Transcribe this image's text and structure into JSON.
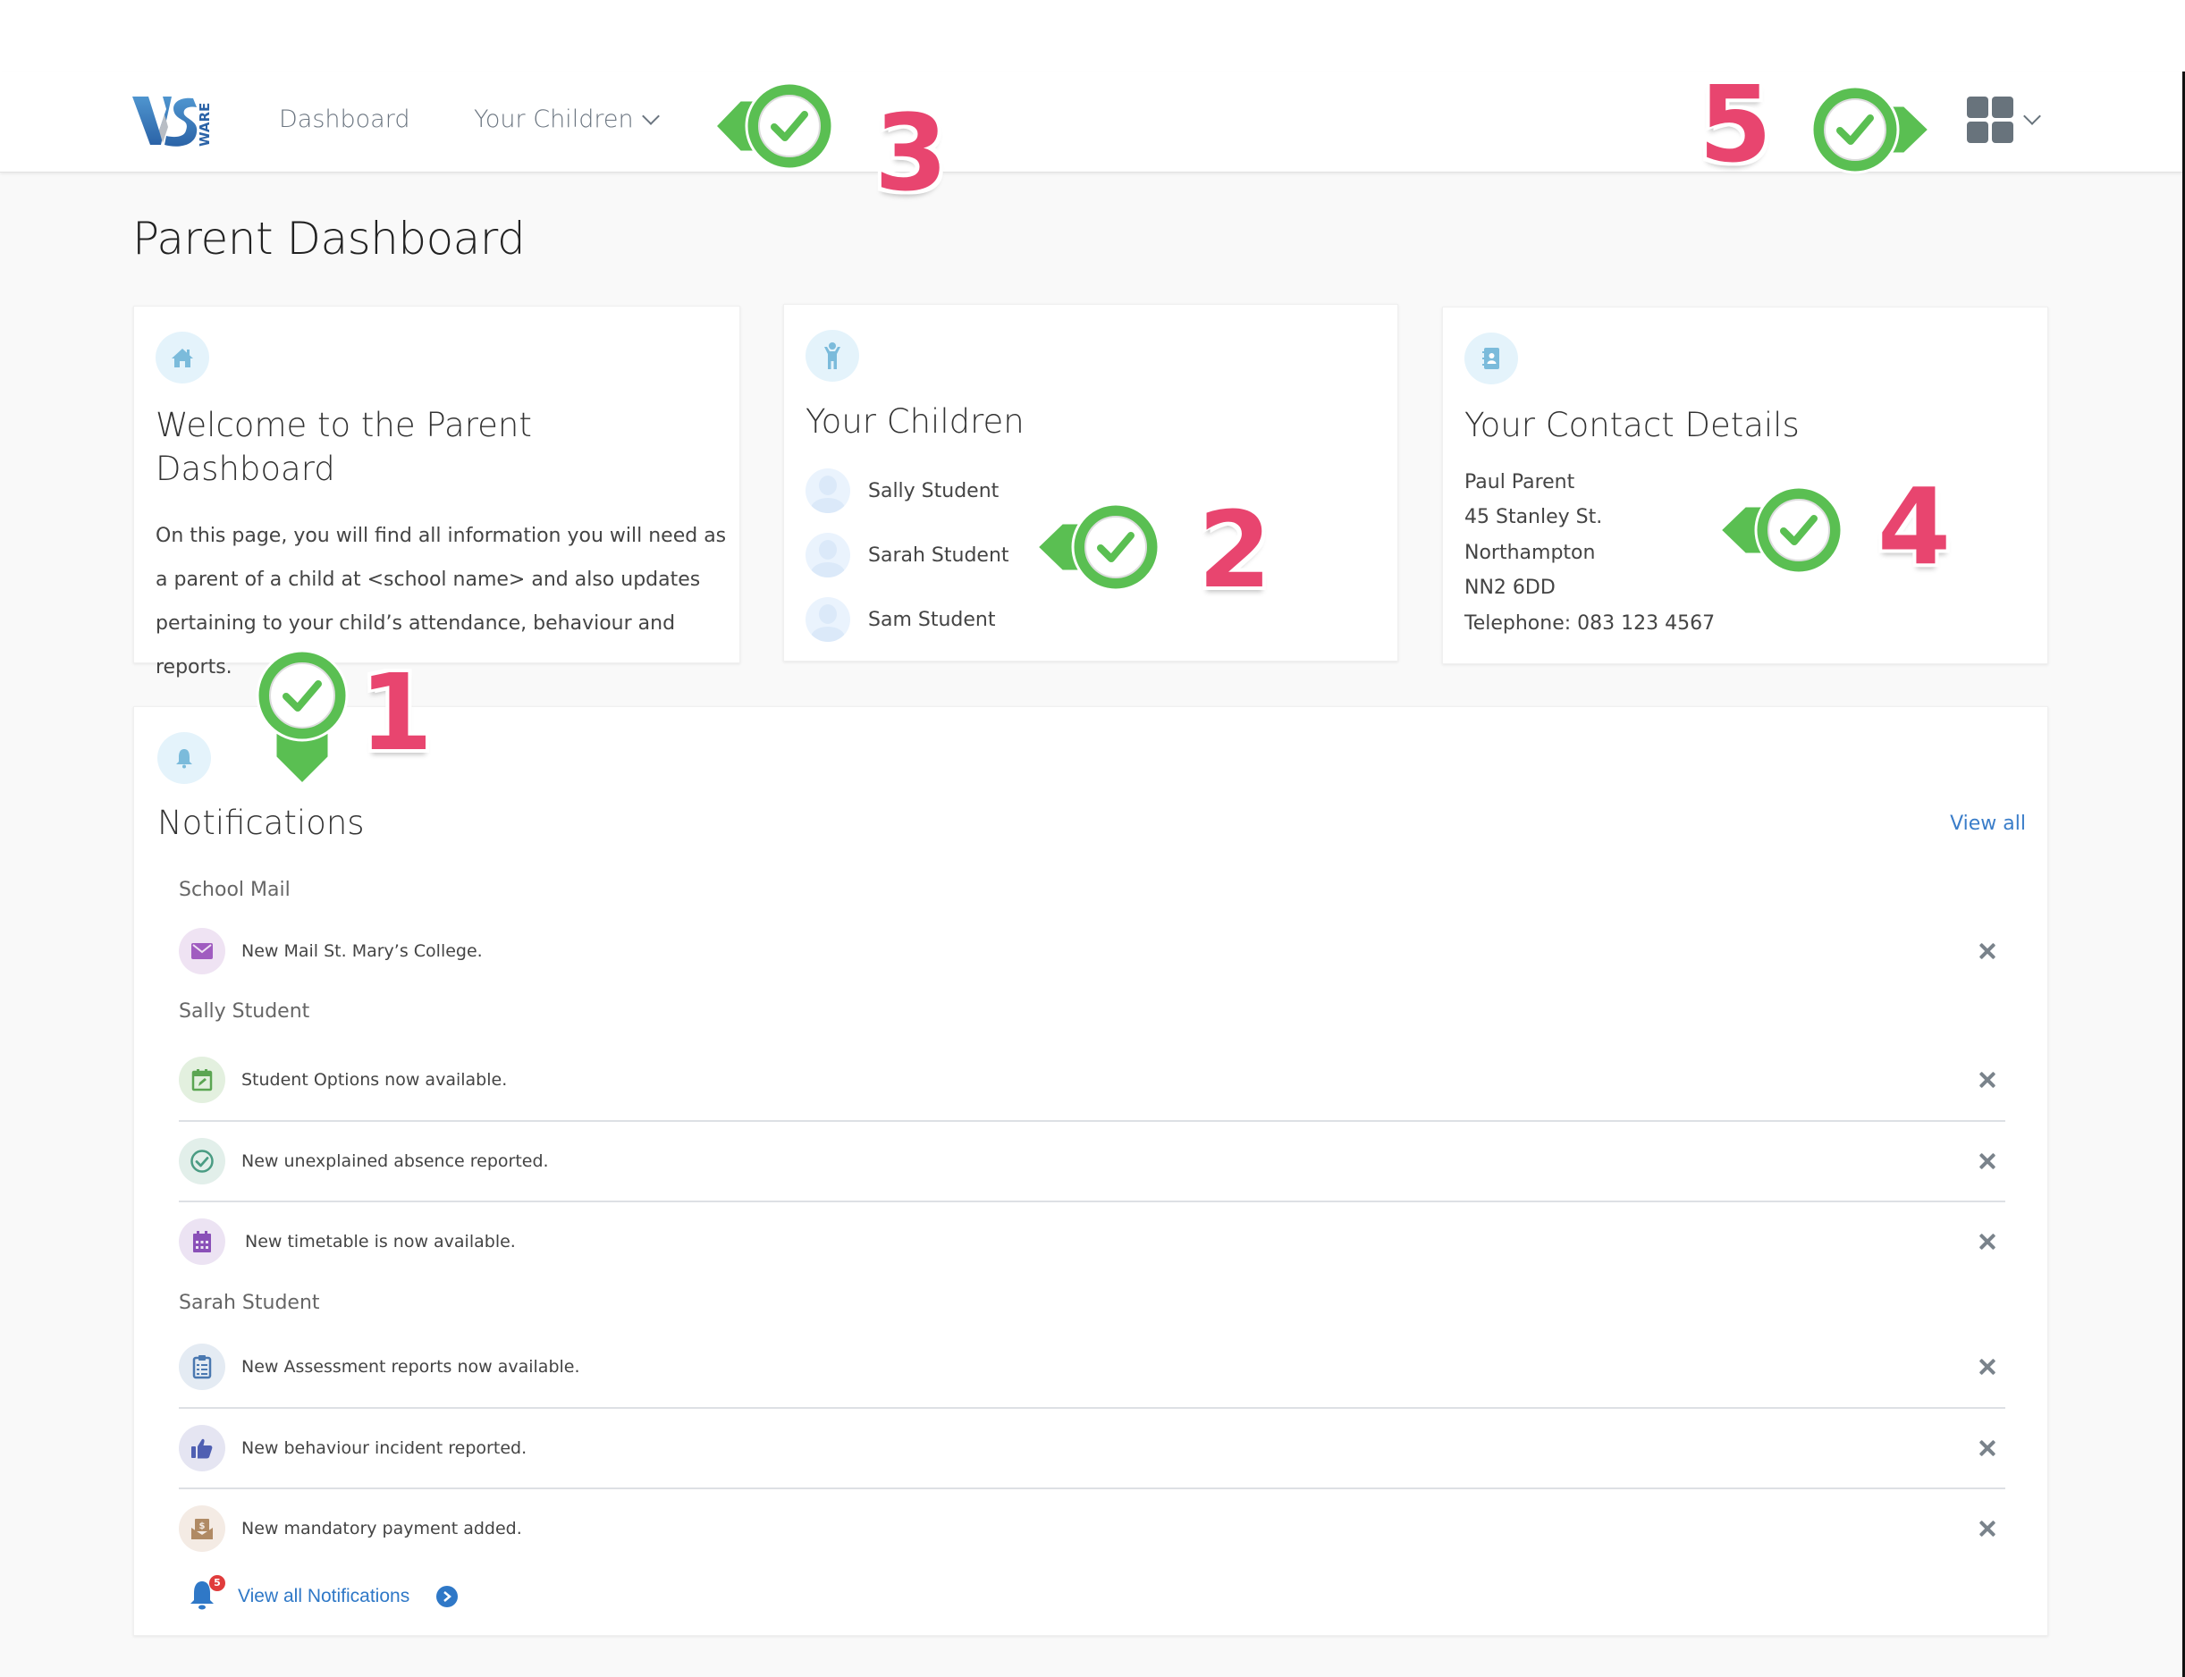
{
  "header": {
    "logo_alt": "VSware",
    "nav": [
      {
        "label": "Dashboard"
      },
      {
        "label": "Your Children",
        "has_dropdown": true
      }
    ],
    "apps_menu_icon": "grid-icon"
  },
  "page": {
    "title": "Parent Dashboard"
  },
  "welcome_card": {
    "icon": "home-icon",
    "title": "Welcome to the Parent Dashboard",
    "body": "On this page, you will find all information you will need as a parent of a child at <school name> and also updates pertaining to your child’s attendance, behaviour and reports."
  },
  "children_card": {
    "icon": "child-icon",
    "title": "Your Children",
    "children": [
      {
        "name": "Sally Student"
      },
      {
        "name": "Sarah Student"
      },
      {
        "name": "Sam Student"
      }
    ]
  },
  "contact_card": {
    "icon": "address-book-icon",
    "title": "Your Contact Details",
    "lines": [
      "Paul Parent",
      "45 Stanley St.",
      "Northampton",
      "NN2 6DD",
      "Telephone: 083 123 4567"
    ]
  },
  "notifications": {
    "icon": "bell-icon",
    "title": "Notifications",
    "view_all_label": "View all",
    "groups": [
      {
        "label": "School Mail",
        "items": [
          {
            "text": "New Mail St. Mary’s College.",
            "icon": "envelope-icon",
            "color": "#a05cc0",
            "bg": "#efe3f3"
          }
        ]
      },
      {
        "label": "Sally Student",
        "items": [
          {
            "text": "Student Options now available.",
            "icon": "calendar-edit-icon",
            "color": "#5ba552",
            "bg": "#e3f0df"
          },
          {
            "text": "New unexplained absence reported.",
            "icon": "check-circle-icon",
            "color": "#4a9c83",
            "bg": "#e2efea"
          },
          {
            "text": "New timetable is now available.",
            "icon": "calendar-icon",
            "color": "#8a50b8",
            "bg": "#ece3f3"
          }
        ]
      },
      {
        "label": "Sarah Student",
        "items": [
          {
            "text": "New Assessment reports now available.",
            "icon": "clipboard-list-icon",
            "color": "#4a78b0",
            "bg": "#e4ebf3"
          },
          {
            "text": "New behaviour incident reported.",
            "icon": "thumbs-up-icon",
            "color": "#4f5fb2",
            "bg": "#e5e5f2"
          },
          {
            "text": "New mandatory payment added.",
            "icon": "payment-envelope-icon",
            "color": "#b08a64",
            "bg": "#f4ebe4"
          }
        ]
      }
    ],
    "footer": {
      "label": "View all Notifications",
      "badge_count": "5"
    }
  },
  "annotations": [
    {
      "number": "1",
      "target": "notifications"
    },
    {
      "number": "2",
      "target": "your-children"
    },
    {
      "number": "3",
      "target": "nav-your-children"
    },
    {
      "number": "4",
      "target": "contact-details"
    },
    {
      "number": "5",
      "target": "apps-menu"
    }
  ],
  "colors": {
    "accent_blue": "#3a7dc9",
    "marker_green": "#5abf52",
    "marker_number": "#e8456f",
    "icon_circle_bg": "#e4f3fb",
    "icon_blue": "#7bbbdb"
  }
}
